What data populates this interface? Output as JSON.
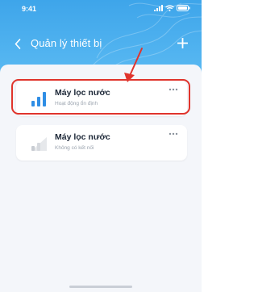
{
  "status_bar": {
    "time": "9:41"
  },
  "header": {
    "title": "Quản lý thiết bị",
    "back_icon": "chevron-left-icon",
    "add_icon": "plus-icon"
  },
  "devices": [
    {
      "name": "Máy lọc nước",
      "status": "Hoạt động ổn định",
      "icon": "signal-strong-icon",
      "highlighted": true
    },
    {
      "name": "Máy lọc nước",
      "status": "Không có kết nối",
      "icon": "signal-none-icon",
      "highlighted": false
    }
  ],
  "colors": {
    "header_top": "#3ea5ea",
    "header_bottom": "#59b9f2",
    "highlight": "#e0342c",
    "signal_active": "#2f8ee5",
    "signal_inactive": "#c8ccd2"
  }
}
